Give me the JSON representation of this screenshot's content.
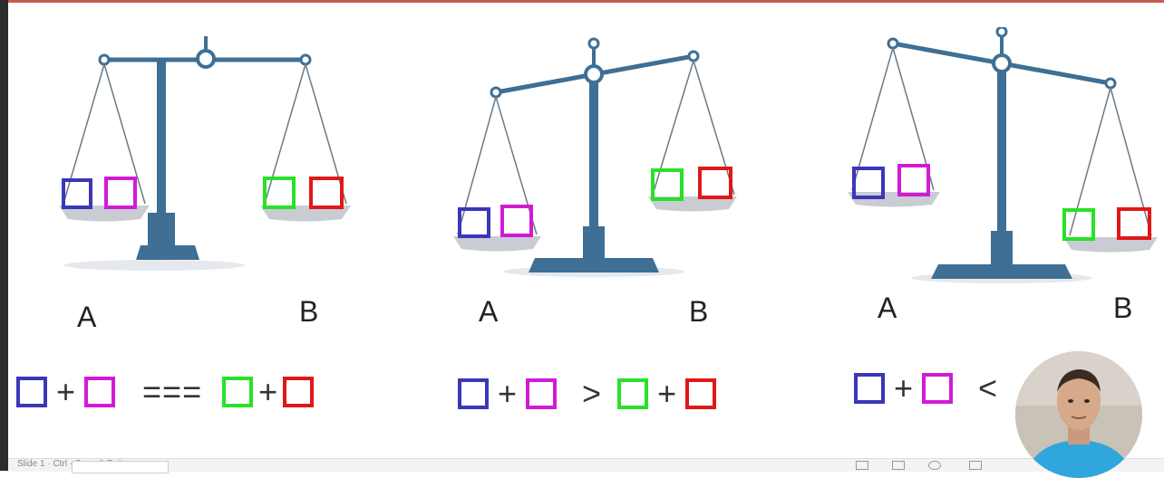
{
  "scales": [
    {
      "left_label": "A",
      "right_label": "B"
    },
    {
      "left_label": "A",
      "right_label": "B"
    },
    {
      "left_label": "A",
      "right_label": "B"
    }
  ],
  "equations": [
    {
      "operator": "===",
      "plus": "+"
    },
    {
      "operator": ">",
      "plus": "+"
    },
    {
      "operator": "<",
      "plus": "+"
    }
  ],
  "colors": {
    "blue": "#3a37b8",
    "magenta": "#d21ad6",
    "green": "#28e128",
    "red": "#e01818",
    "scale": "#3f6f94",
    "pan": "#c9ccd2"
  },
  "statusbar": {
    "text": "Slide 1 · Ctrl · Save & Exit"
  }
}
